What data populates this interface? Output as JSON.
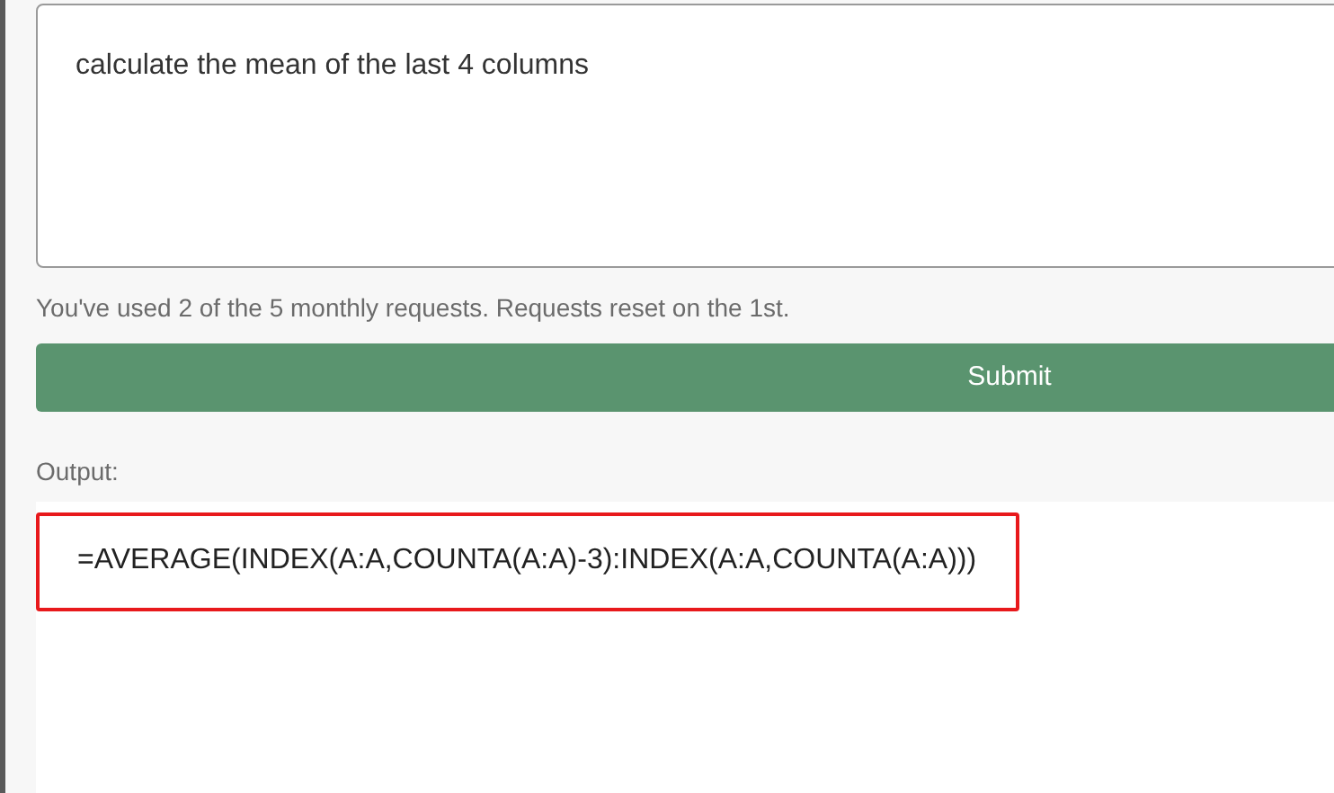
{
  "prompt": {
    "value": "calculate the mean of the last 4 columns"
  },
  "usage_note": "You've used 2 of the 5 monthly requests. Requests reset on the 1st.",
  "submit_button": {
    "label": "Submit"
  },
  "output": {
    "label": "Output:",
    "formula": "=AVERAGE(INDEX(A:A,COUNTA(A:A)-3):INDEX(A:A,COUNTA(A:A)))",
    "highlighted": true
  }
}
